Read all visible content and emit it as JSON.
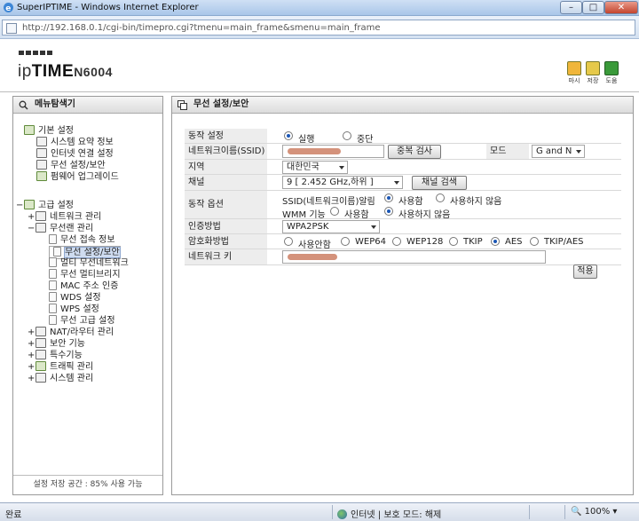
{
  "window": {
    "title": "SuperIPTIME - Windows Internet Explorer"
  },
  "address": {
    "url": "http://192.168.0.1/cgi-bin/timepro.cgi?tmenu=main_frame&smenu=main_frame"
  },
  "header": {
    "brand_a": "ip",
    "brand_b": "TIME",
    "model": "N6004",
    "icons": [
      {
        "label": "마시",
        "icon": "back-icon",
        "color": "#f0b63a"
      },
      {
        "label": "저장",
        "icon": "save-icon",
        "color": "#e6c94a"
      },
      {
        "label": "도움",
        "icon": "help-icon",
        "color": "#3a9a3a"
      }
    ]
  },
  "nav": {
    "title": "메뉴탐색기",
    "basic": {
      "label": "기본 설정",
      "items": [
        "시스템 요약 정보",
        "인터넷 연결 설정",
        "무선 설정/보안",
        "펌웨어 업그레이드"
      ]
    },
    "advanced": {
      "label": "고급 설정",
      "network": "네트워크 관리",
      "wireless": "무선랜 관리",
      "wireless_items": [
        "무선 접속 정보",
        "무선 설정/보안",
        "멀티 무선네트워크",
        "무선 멀티브리지",
        "MAC 주소 인증",
        "WDS 설정",
        "WPS 설정",
        "무선 고급 설정"
      ],
      "others": [
        "NAT/라우터 관리",
        "보안 기능",
        "특수기능",
        "트래픽 관리",
        "시스템 관리"
      ]
    },
    "footer": "설정 저장 공간 : 85% 사용 가능"
  },
  "main": {
    "title": "무선 설정/보안",
    "op_label": "동작 설정",
    "op_run": "실행",
    "op_stop": "중단",
    "ssid_label": "네트워크이름(SSID)",
    "dup_check": "중복 검사",
    "mode_label": "모드",
    "mode_value": "G and N",
    "region_label": "지역",
    "region_value": "대한민국",
    "channel_label": "채널",
    "channel_value": "9 [ 2.452 GHz,하위 ]",
    "channel_search": "채널 검색",
    "opt_label": "동작 옵션",
    "ssid_bcast_label": "SSID(네트워크이름)알림",
    "use": "사용함",
    "nouse": "사용하지 않음",
    "wmm_label": "WMM 기능",
    "wmm_use": "사용함",
    "wmm_nouse": "사용하지 않음",
    "auth_label": "인증방법",
    "auth_value": "WPA2PSK",
    "enc_label": "암호화방법",
    "enc_options": [
      "사용안함",
      "WEP64",
      "WEP128",
      "TKIP",
      "AES",
      "TKIP/AES"
    ],
    "key_label": "네트워크 키",
    "apply": "적용"
  },
  "status": {
    "left": "완료",
    "zone": "인터넷 | 보호 모드: 해제",
    "zoom": "100%"
  }
}
